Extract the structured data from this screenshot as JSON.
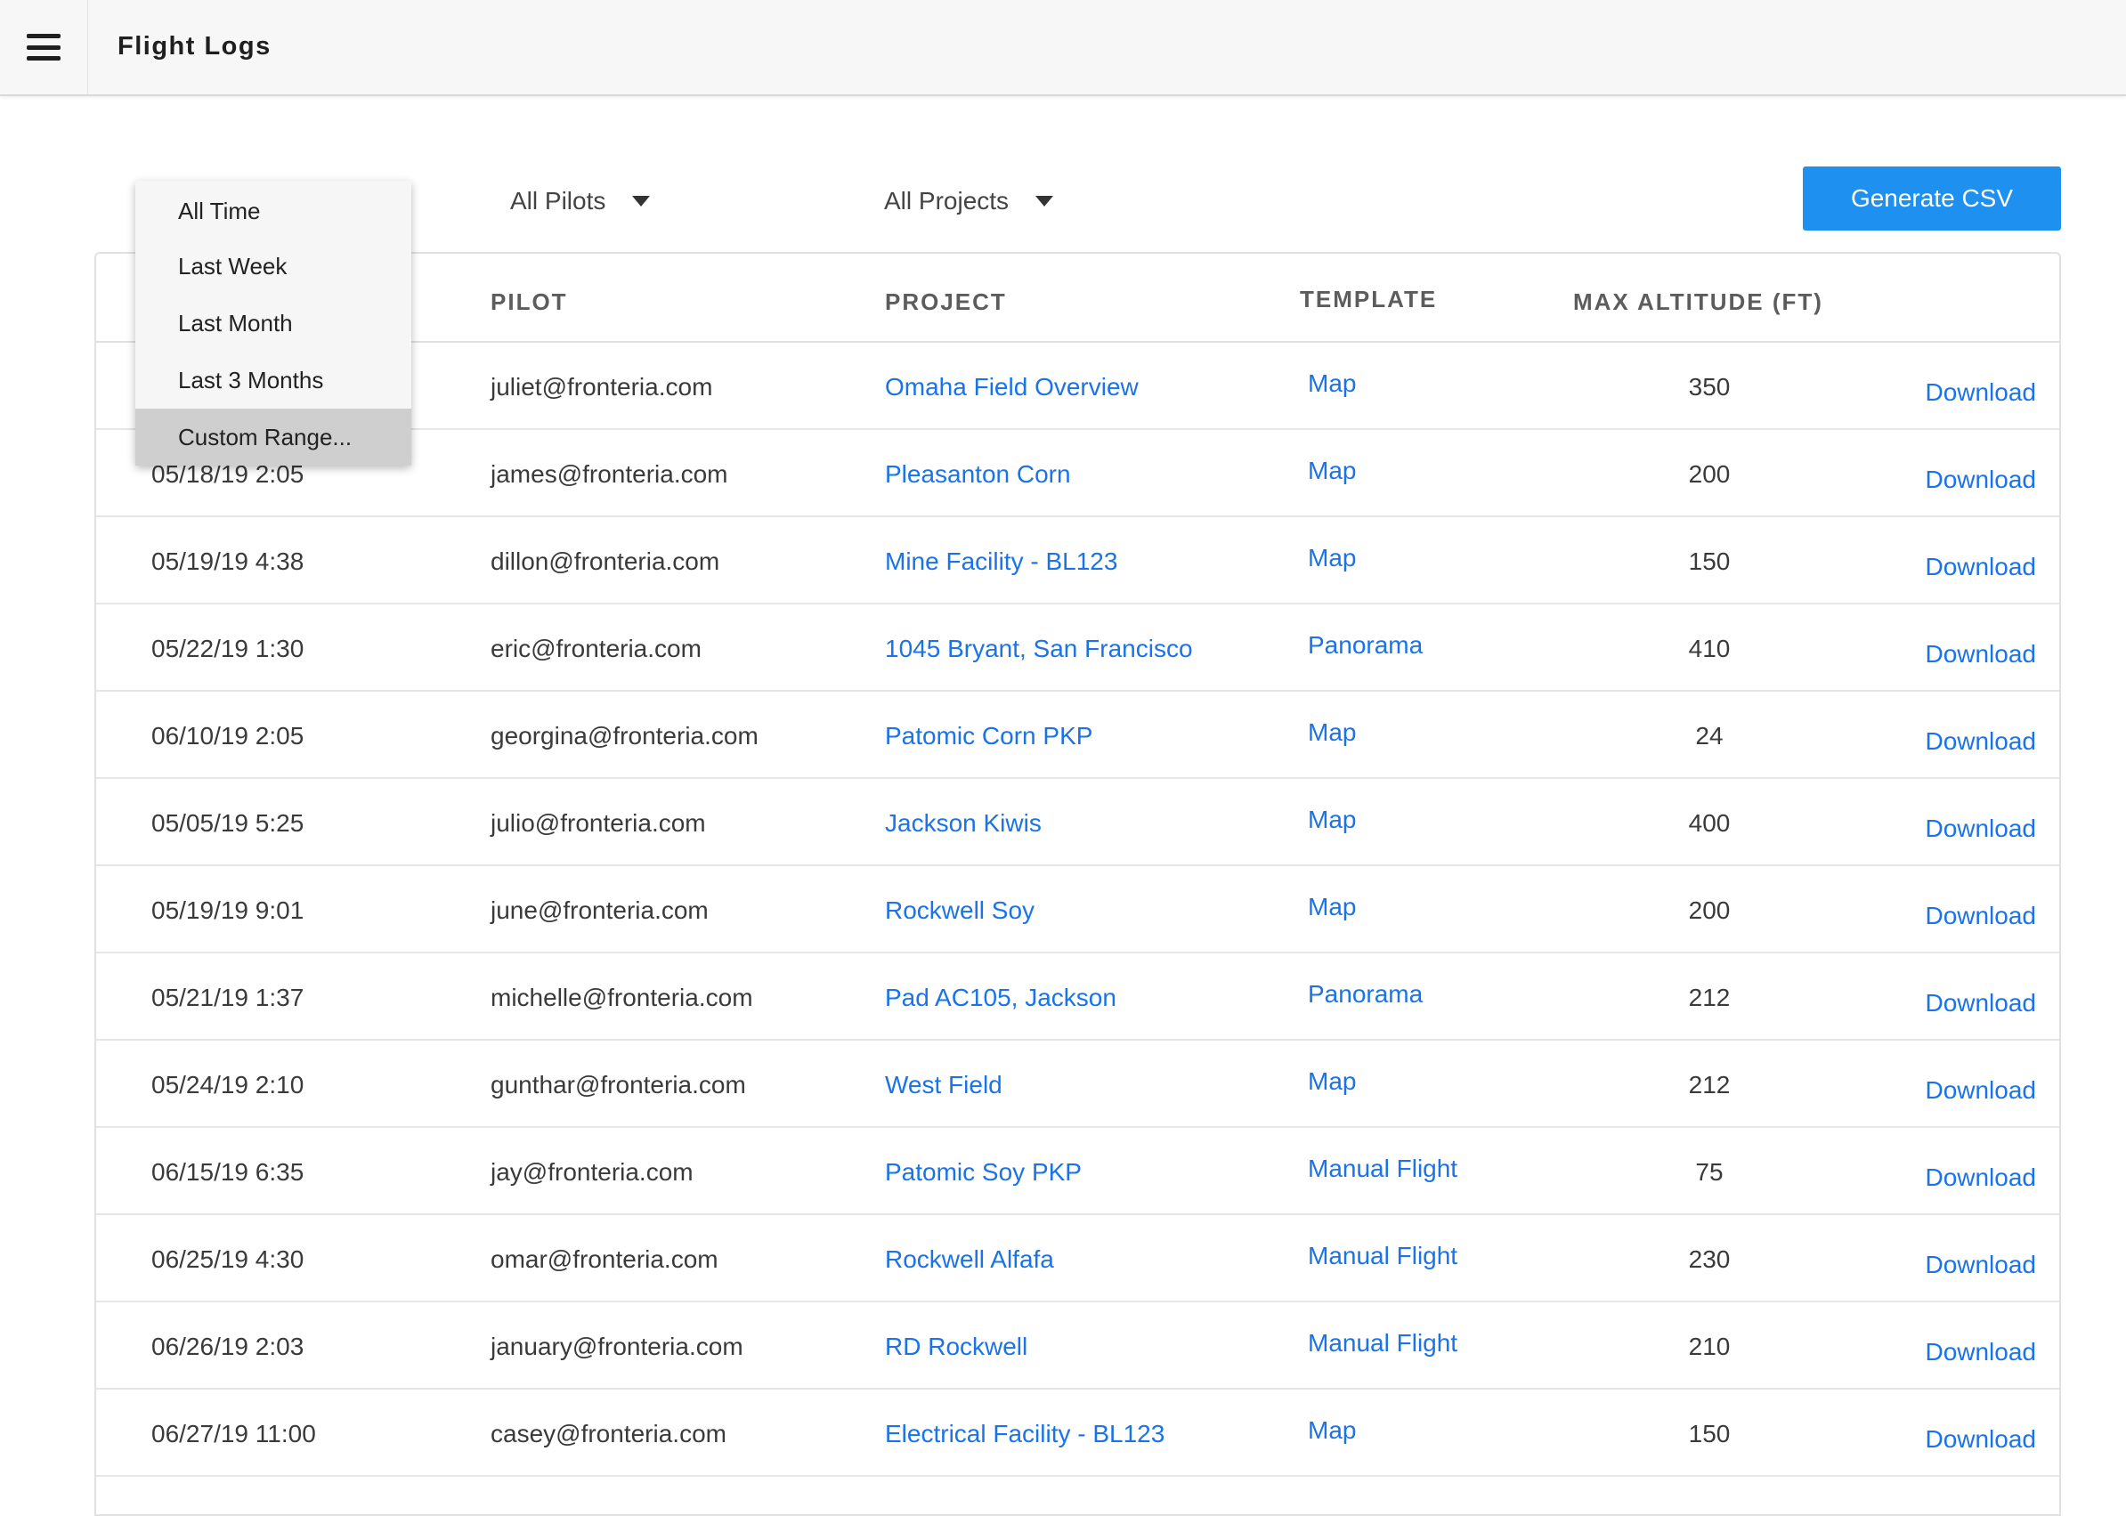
{
  "header": {
    "title": "Flight Logs",
    "menu_icon": "hamburger-menu-icon"
  },
  "filters": {
    "pilots": {
      "label": "All Pilots"
    },
    "projects": {
      "label": "All Projects"
    },
    "time_range": {
      "options": [
        "All Time",
        "Last Week",
        "Last Month",
        "Last 3 Months",
        "Custom Range..."
      ],
      "highlighted": "Custom Range..."
    }
  },
  "actions": {
    "generate_csv": "Generate CSV"
  },
  "table": {
    "columns": [
      "PILOT",
      "PROJECT",
      "TEMPLATE",
      "MAX ALTITUDE (FT)"
    ],
    "rows": [
      {
        "date": "",
        "pilot": "juliet@fronteria.com",
        "project": "Omaha Field Overview",
        "template": "Map",
        "altitude": "350",
        "action": "Download"
      },
      {
        "date": "05/18/19 2:05",
        "pilot": "james@fronteria.com",
        "project": "Pleasanton Corn",
        "template": "Map",
        "altitude": "200",
        "action": "Download"
      },
      {
        "date": "05/19/19 4:38",
        "pilot": "dillon@fronteria.com",
        "project": "Mine Facility - BL123",
        "template": "Map",
        "altitude": "150",
        "action": "Download"
      },
      {
        "date": "05/22/19 1:30",
        "pilot": "eric@fronteria.com",
        "project": "1045 Bryant, San Francisco",
        "template": "Panorama",
        "altitude": "410",
        "action": "Download"
      },
      {
        "date": "06/10/19 2:05",
        "pilot": "georgina@fronteria.com",
        "project": "Patomic Corn PKP",
        "template": "Map",
        "altitude": "24",
        "action": "Download"
      },
      {
        "date": "05/05/19 5:25",
        "pilot": "julio@fronteria.com",
        "project": "Jackson Kiwis",
        "template": "Map",
        "altitude": "400",
        "action": "Download"
      },
      {
        "date": "05/19/19 9:01",
        "pilot": "june@fronteria.com",
        "project": "Rockwell Soy",
        "template": "Map",
        "altitude": "200",
        "action": "Download"
      },
      {
        "date": "05/21/19 1:37",
        "pilot": "michelle@fronteria.com",
        "project": "Pad AC105, Jackson",
        "template": "Panorama",
        "altitude": "212",
        "action": "Download"
      },
      {
        "date": "05/24/19 2:10",
        "pilot": "gunthar@fronteria.com",
        "project": "West Field",
        "template": "Map",
        "altitude": "212",
        "action": "Download"
      },
      {
        "date": "06/15/19 6:35",
        "pilot": "jay@fronteria.com",
        "project": "Patomic Soy PKP",
        "template": "Manual Flight",
        "altitude": "75",
        "action": "Download"
      },
      {
        "date": "06/25/19 4:30",
        "pilot": "omar@fronteria.com",
        "project": "Rockwell Alfafa",
        "template": "Manual Flight",
        "altitude": "230",
        "action": "Download"
      },
      {
        "date": "06/26/19 2:03",
        "pilot": "january@fronteria.com",
        "project": "RD Rockwell",
        "template": "Manual Flight",
        "altitude": "210",
        "action": "Download"
      },
      {
        "date": "06/27/19 11:00",
        "pilot": "casey@fronteria.com",
        "project": "Electrical Facility - BL123",
        "template": "Map",
        "altitude": "150",
        "action": "Download"
      }
    ]
  }
}
